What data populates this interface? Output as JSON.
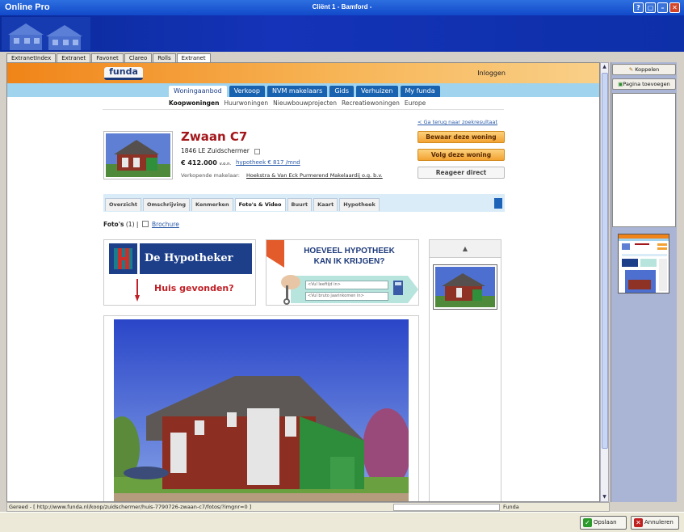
{
  "window": {
    "app_title": "Online Pro",
    "title": "Cliënt 1  -  Bamford -",
    "buttons": {
      "help": "?",
      "restore": "▢",
      "minimize": "–",
      "close": "✕"
    }
  },
  "app_tabs": [
    {
      "label": "ExtranetIndex",
      "active": false
    },
    {
      "label": "Extranet",
      "active": false
    },
    {
      "label": "Favonet",
      "active": false
    },
    {
      "label": "Clareo",
      "active": false
    },
    {
      "label": "Rolls",
      "active": false
    },
    {
      "label": "Extranet",
      "active": true
    }
  ],
  "funda": {
    "logo": "funda",
    "login": "Inloggen",
    "nav": [
      {
        "label": "Woningaanbod",
        "active": true
      },
      {
        "label": "Verkoop",
        "active": false
      },
      {
        "label": "NVM makelaars",
        "active": false
      },
      {
        "label": "Gids",
        "active": false
      },
      {
        "label": "Verhuizen",
        "active": false
      },
      {
        "label": "My funda",
        "active": false
      }
    ],
    "subnav": [
      {
        "label": "Koopwoningen",
        "active": true
      },
      {
        "label": "Huurwoningen",
        "active": false
      },
      {
        "label": "Nieuwbouwprojecten",
        "active": false
      },
      {
        "label": "Recreatiewoningen",
        "active": false
      },
      {
        "label": "Europe",
        "active": false
      }
    ],
    "back_link": "< Ga terug naar zoekresultaat",
    "listing": {
      "title": "Zwaan C7",
      "address": "1846 LE Zuidschermer",
      "price": "€ 412.000",
      "price_suffix": "v.o.n.",
      "mortgage_link": "hypotheek € 817 /mnd",
      "agent_label": "Verkopende makelaar:",
      "agent_name": "Hoekstra & Van Eck Purmerend Makelaardij o.g. b.v."
    },
    "actions": {
      "save": "Bewaar deze woning",
      "follow": "Volg deze woning",
      "respond": "Reageer direct"
    },
    "detail_tabs": [
      {
        "label": "Overzicht",
        "active": false
      },
      {
        "label": "Omschrijving",
        "active": false
      },
      {
        "label": "Kenmerken",
        "active": false
      },
      {
        "label": "Foto's & Video",
        "active": true
      },
      {
        "label": "Buurt",
        "active": false
      },
      {
        "label": "Kaart",
        "active": false
      },
      {
        "label": "Hypotheek",
        "active": false
      }
    ],
    "photos_label": "Foto's",
    "photos_count": "(1)",
    "photos_separator": "|",
    "brochure_link": "Brochure",
    "ad1": {
      "brand": "De Hypotheker",
      "tagline": "Huis gevonden?"
    },
    "ad2": {
      "title_line1": "HOEVEEL HYPOTHEEK",
      "title_line2": "KAN IK KRIJGEN?",
      "field1": "<Vul leeftijd in>",
      "field2": "<Vul bruto jaarinkomen in>"
    },
    "gallery_up": "▲"
  },
  "status": {
    "url": "Gereed - [ http://www.funda.nl/koop/zuidschermer/huis-7790726-zwaan-c7/fotos/?imgnr=0 ]",
    "zone": "Funda"
  },
  "right_panel": {
    "koppelen": "Koppelen",
    "pagina_toevoegen": "Pagina toevoegen"
  },
  "bottom": {
    "save": "Opslaan",
    "cancel": "Annuleren"
  },
  "colors": {
    "titlebar": "#1149c9",
    "funda_orange": "#f08418",
    "funda_blue": "#1862b0",
    "listing_red": "#a3161a"
  }
}
